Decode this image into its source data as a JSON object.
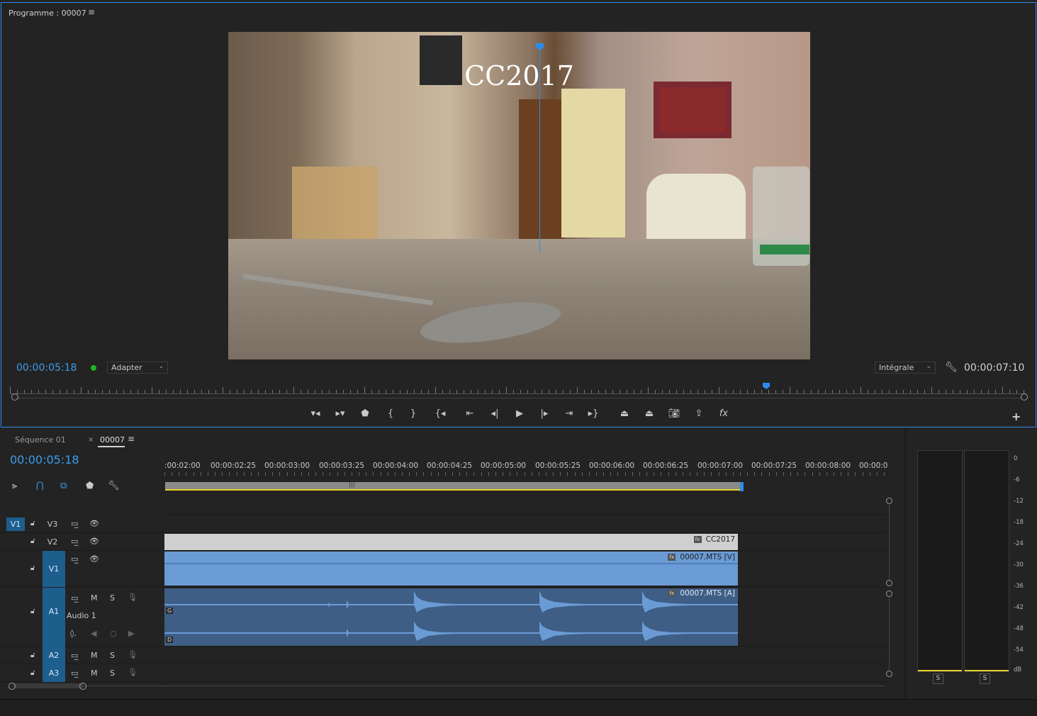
{
  "monitor": {
    "title": "Programme : 00007",
    "menu_icon": "≡",
    "overlay_title": "CC2017",
    "timecode": "00:00:05:18",
    "fit_select": "Adapter",
    "quality_select": "Intégrale",
    "duration": "00:00:07:10",
    "add_button": "+"
  },
  "timeline": {
    "tabs": [
      {
        "label": "Séquence 01"
      },
      {
        "label": "00007"
      }
    ],
    "close_icon": "×",
    "menu_icon": "≡",
    "timecode": "00:00:05:18",
    "ruler_labels": [
      ":00:02:00",
      "00:00:02:25",
      "00:00:03:00",
      "00:00:03:25",
      "00:00:04:00",
      "00:00:04:25",
      "00:00:05:00",
      "00:00:05:25",
      "00:00:06:00",
      "00:00:06:25",
      "00:00:07:00",
      "00:00:07:25",
      "00:00:08:00",
      "00:00:0"
    ],
    "source_patch_video": "V1",
    "tracks": {
      "v3": "V3",
      "v2": "V2",
      "v1": "V1",
      "a1": "A1",
      "a1_name": "Audio 1",
      "a2": "A2",
      "a3": "A3",
      "mute": "M",
      "solo": "S"
    },
    "clips": {
      "title": "CC2017",
      "video": "00007.MTS [V]",
      "audio": "00007.MTS [A]",
      "fx": "fx",
      "channel_left": "G",
      "channel_right": "D"
    }
  },
  "meters": {
    "scale": [
      "0",
      "-6",
      "-12",
      "-18",
      "-24",
      "-30",
      "-36",
      "-42",
      "-48",
      "-54",
      "dB"
    ],
    "solo_left": "S",
    "solo_right": "S",
    "level": 0.0
  },
  "colors": {
    "accent": "#2d8ceb",
    "timecode": "#3c9ded",
    "video_clip": "#6b9bd4",
    "audio_clip": "#3e5e86",
    "title_clip": "#cfcfcf",
    "workbar": "#e6d12a"
  }
}
